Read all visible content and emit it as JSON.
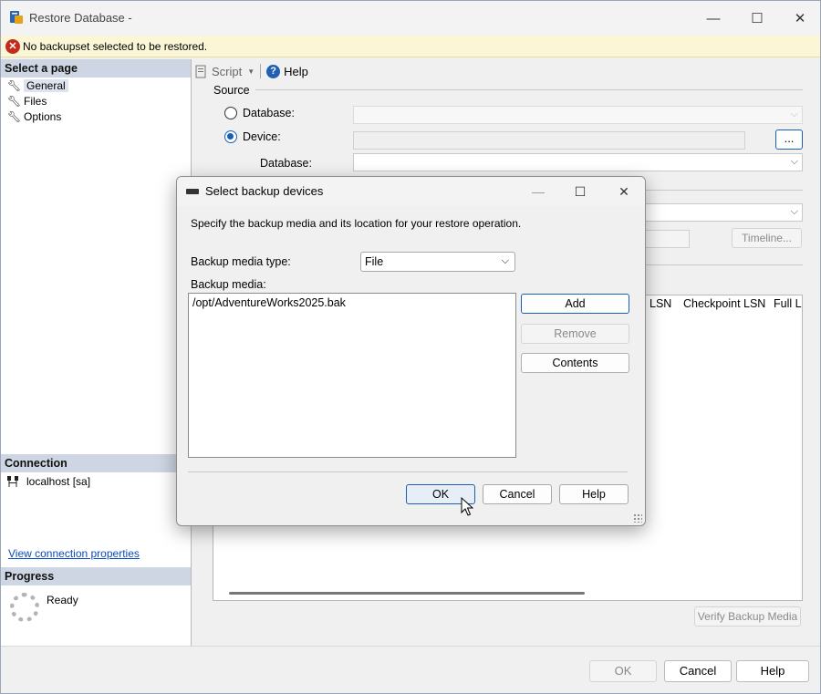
{
  "window": {
    "title": "Restore Database -",
    "controls": {
      "minimize": "—",
      "maximize": "☐",
      "close": "✕"
    }
  },
  "infobar": {
    "message": "No backupset selected to be restored."
  },
  "left_pane": {
    "select_page_header": "Select a page",
    "pages": [
      {
        "label": "General",
        "selected": true
      },
      {
        "label": "Files",
        "selected": false
      },
      {
        "label": "Options",
        "selected": false
      }
    ],
    "connection_header": "Connection",
    "connection_value": "localhost [sa]",
    "connection_link": "View connection properties",
    "progress_header": "Progress",
    "progress_status": "Ready"
  },
  "toolbar": {
    "script_label": "Script",
    "help_label": "Help"
  },
  "source": {
    "group_label": "Source",
    "database_radio": "Database:",
    "device_radio": "Device:",
    "device_browse": "...",
    "database_label": "Database:",
    "selected_radio": "device"
  },
  "destination": {
    "timeline_button": "Timeline..."
  },
  "backup_grid": {
    "columns_visible": [
      "LSN",
      "Checkpoint LSN",
      "Full LS"
    ]
  },
  "verify_button": "Verify Backup Media",
  "footer": {
    "ok": "OK",
    "cancel": "Cancel",
    "help": "Help"
  },
  "dialog": {
    "title": "Select backup devices",
    "controls": {
      "minimize": "—",
      "maximize": "☐",
      "close": "✕"
    },
    "description": "Specify the backup media and its location for your restore operation.",
    "media_type_label": "Backup media type:",
    "media_type_value": "File",
    "media_label": "Backup media:",
    "media_items": [
      "/opt/AdventureWorks2025.bak"
    ],
    "add_button": "Add",
    "remove_button": "Remove",
    "contents_button": "Contents",
    "ok_button": "OK",
    "cancel_button": "Cancel",
    "help_button": "Help"
  },
  "colors": {
    "accent": "#1a5fb4",
    "error": "#c42b1c",
    "infobar_bg": "#fbf6d6",
    "section_header_bg": "#cdd6e2",
    "link": "#0a4cc2"
  },
  "icons": [
    "app-db-icon",
    "error-icon",
    "wrench-icon",
    "connection-icon",
    "script-icon",
    "help-icon",
    "dialog-device-icon",
    "mouse-cursor-icon"
  ]
}
